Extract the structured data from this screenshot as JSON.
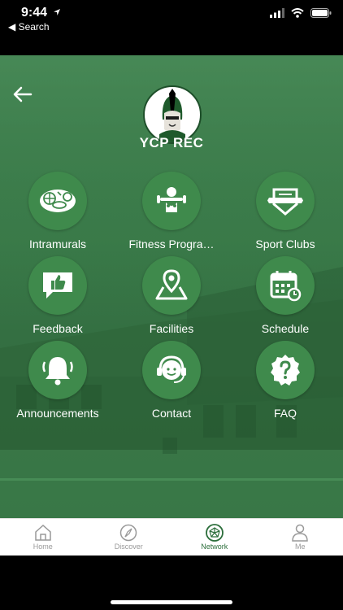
{
  "status": {
    "time": "9:44",
    "back_app": "◀ Search"
  },
  "header": {
    "title": "YCP REC"
  },
  "tiles": [
    {
      "label": "Intramurals",
      "icon": "sports-balls-icon"
    },
    {
      "label": "Fitness Progra…",
      "icon": "fitness-trainer-icon"
    },
    {
      "label": "Sport Clubs",
      "icon": "sport-club-badge-icon"
    },
    {
      "label": "Feedback",
      "icon": "thumbs-up-feedback-icon"
    },
    {
      "label": "Facilities",
      "icon": "map-location-icon"
    },
    {
      "label": "Schedule",
      "icon": "calendar-schedule-icon"
    },
    {
      "label": "Announcements",
      "icon": "bell-icon"
    },
    {
      "label": "Contact",
      "icon": "headset-contact-icon"
    },
    {
      "label": "FAQ",
      "icon": "question-badge-icon"
    }
  ],
  "tabbar": {
    "items": [
      {
        "label": "Home",
        "icon": "home-icon",
        "active": false
      },
      {
        "label": "Discover",
        "icon": "compass-icon",
        "active": false
      },
      {
        "label": "Network",
        "icon": "network-icon",
        "active": true
      },
      {
        "label": "Me",
        "icon": "person-icon",
        "active": false
      }
    ]
  },
  "colors": {
    "accent": "#2c6e3b",
    "tile": "#3f8a4c",
    "background": "#3a7b49"
  }
}
